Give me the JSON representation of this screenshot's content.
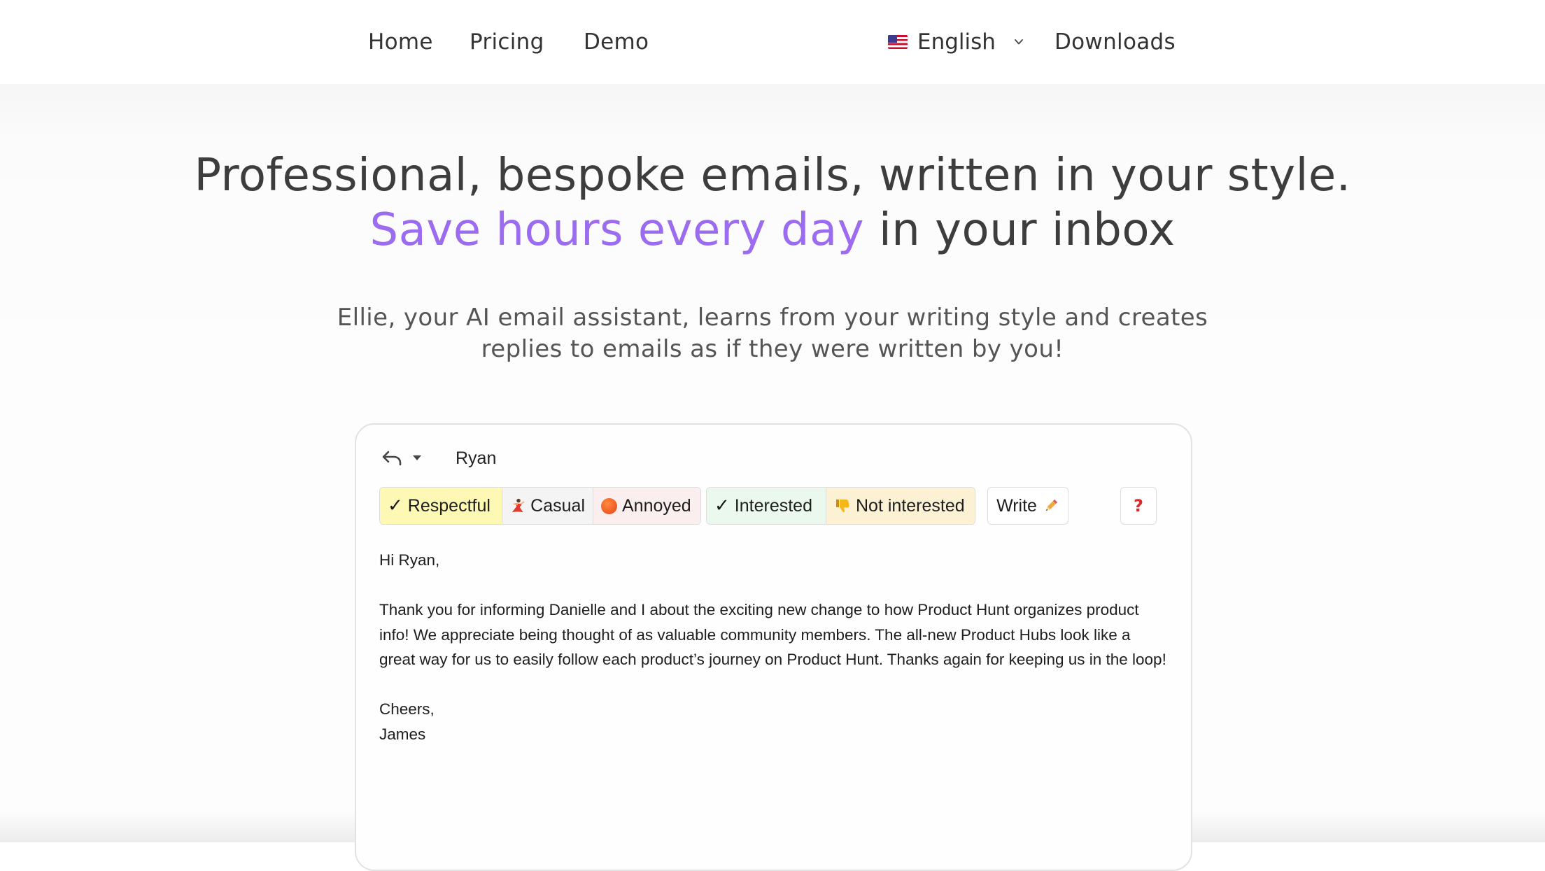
{
  "nav": {
    "home": "Home",
    "pricing": "Pricing",
    "demo": "Demo",
    "language": "English",
    "downloads": "Downloads"
  },
  "hero": {
    "headline_part1": "Professional, bespoke emails, written in your style.",
    "headline_accent": "Save hours every day",
    "headline_part2": "in your inbox",
    "subhead": "Ellie, your AI email assistant, learns from your writing style and creates replies to emails as if they were written by you!",
    "accent_color": "#9b6bf0"
  },
  "email": {
    "recipient": "Ryan",
    "tones": [
      {
        "label": "Respectful",
        "selected": true
      },
      {
        "label": "Casual",
        "selected": false
      },
      {
        "label": "Annoyed",
        "selected": false
      }
    ],
    "intents": [
      {
        "label": "Interested",
        "selected": true
      },
      {
        "label": "Not interested",
        "selected": false
      }
    ],
    "write_label": "Write",
    "help_label": "?",
    "greeting": "Hi Ryan,",
    "body": "Thank you for informing Danielle and I about the exciting new change to how Product Hunt organizes product info! We appreciate being thought of as valuable community members. The all-new Product Hubs look like a great way for us to easily follow each product’s journey on Product Hunt. Thanks again for keeping us in the loop!",
    "signoff": "Cheers,",
    "signature": "James"
  },
  "icons": {
    "reply": "reply-arrow-icon",
    "caret": "caret-down-icon",
    "flag": "us-flag-icon",
    "check": "checkmark-icon",
    "dancer": "dancer-emoji-icon",
    "angry": "angry-face-emoji-icon",
    "thumbs_down": "thumbs-down-emoji-icon",
    "pencil": "pencil-emoji-icon"
  }
}
